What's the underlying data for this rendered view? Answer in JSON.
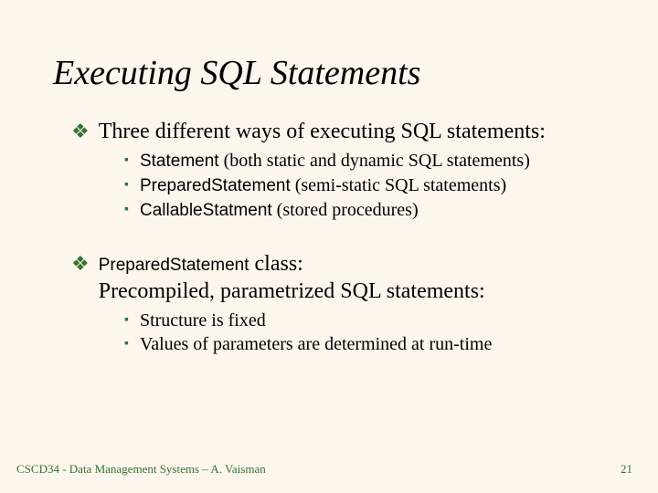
{
  "title": "Executing SQL Statements",
  "bullets": [
    {
      "text": "Three different ways of executing SQL statements:",
      "sub": [
        {
          "code": "Statement",
          "rest": " (both static and dynamic SQL statements)"
        },
        {
          "code": "PreparedStatement",
          "rest": " (semi-static SQL statements)"
        },
        {
          "code": "CallableStatment",
          "rest": " (stored procedures)"
        }
      ]
    },
    {
      "code_prefix": "PreparedStatement",
      "text": " class:",
      "text2": "Precompiled, parametrized SQL statements:",
      "sub": [
        {
          "plain": "Structure is fixed"
        },
        {
          "plain": "Values of parameters are determined at run-time"
        }
      ]
    }
  ],
  "footer": {
    "left": "CSCD34 - Data Management Systems – A. Vaisman",
    "right": "21"
  },
  "glyphs": {
    "diamond": "❖",
    "square": "▪"
  }
}
